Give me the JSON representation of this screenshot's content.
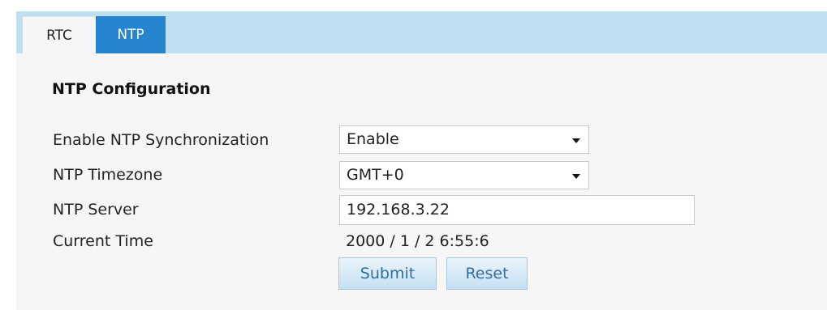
{
  "tabs": [
    {
      "label": "RTC",
      "active": false
    },
    {
      "label": "NTP",
      "active": true
    }
  ],
  "section_title": "NTP Configuration",
  "fields": {
    "enable_sync": {
      "label": "Enable NTP Synchronization",
      "value": "Enable"
    },
    "timezone": {
      "label": "NTP Timezone",
      "value": "GMT+0"
    },
    "server": {
      "label": "NTP Server",
      "value": "192.168.3.22"
    },
    "current_time": {
      "label": "Current Time",
      "value": "2000 / 1 / 2 6:55:6"
    }
  },
  "buttons": {
    "submit": "Submit",
    "reset": "Reset"
  },
  "colors": {
    "tabbar": "#bfe0f1",
    "active_tab": "#2585cf",
    "panel": "#f6f6f6"
  },
  "icons": {
    "dropdown": "chevron-down-icon"
  }
}
